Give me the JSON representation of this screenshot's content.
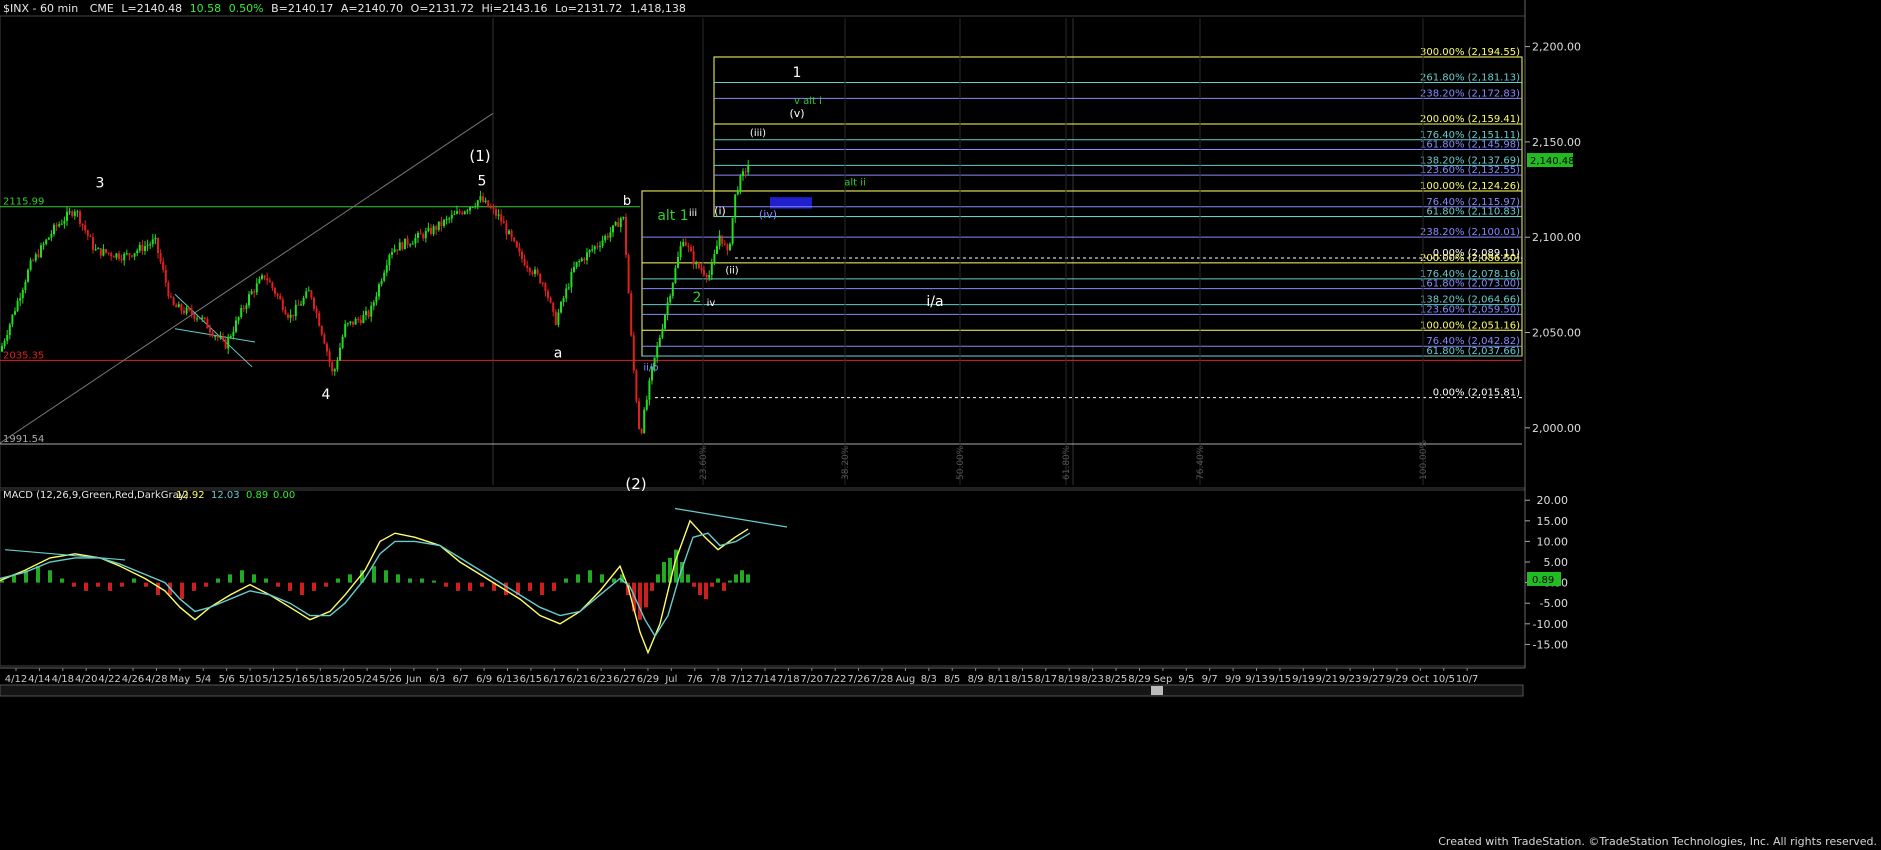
{
  "header": {
    "symbol": "$INX - 60 min",
    "exchange": "CME",
    "last": "L=2140.48",
    "change": "10.58",
    "change_pct": "0.50%",
    "bid": "B=2140.17",
    "ask": "A=2140.70",
    "open": "O=2131.72",
    "high": "Hi=2143.16",
    "low": "Lo=2131.72",
    "volume": "1,418,138"
  },
  "colors": {
    "background": "#000000",
    "up_bar": "#22dd22",
    "down_bar": "#e02020",
    "fib_yellow": "#ffff66",
    "fib_blue": "#8888ff",
    "fib_teal": "#66cccc",
    "macd_line": "#ffff66",
    "signal_line": "#66cccc",
    "hist_pos": "#22aa22",
    "hist_neg": "#cc2020",
    "wave_label": "#ffffff",
    "green_label": "#33cc33"
  },
  "chart_data": [
    {
      "type": "candlestick",
      "title": "$INX - 60 min",
      "y_ticks": [
        "2,200.00",
        "2,150.00",
        "2,100.00",
        "2,050.00",
        "2,000.00"
      ],
      "ylim": [
        1970,
        2215
      ],
      "last_price_label": "2,140.48",
      "x_ticks": [
        "4/12",
        "4/14",
        "4/18",
        "4/20",
        "4/22",
        "4/26",
        "4/28",
        "May",
        "5/4",
        "5/6",
        "5/10",
        "5/12",
        "5/16",
        "5/18",
        "5/20",
        "5/24",
        "5/26",
        "Jun",
        "6/3",
        "6/7",
        "6/9",
        "6/13",
        "6/15",
        "6/17",
        "6/21",
        "6/23",
        "6/27",
        "6/29",
        "Jul",
        "7/6",
        "7/8",
        "7/12",
        "7/14",
        "7/18",
        "7/20",
        "7/22",
        "7/26",
        "7/28",
        "Aug",
        "8/3",
        "8/5",
        "8/9",
        "8/11",
        "8/15",
        "8/17",
        "8/19",
        "8/23",
        "8/25",
        "8/29",
        "Sep",
        "9/5",
        "9/7",
        "9/9",
        "9/13",
        "9/15",
        "9/19",
        "9/21",
        "9/23",
        "9/27",
        "9/29",
        "Oct",
        "10/5",
        "10/7"
      ],
      "price_path": [
        {
          "x": 0,
          "y": 2040
        },
        {
          "x": 30,
          "y": 2085
        },
        {
          "x": 55,
          "y": 2105
        },
        {
          "x": 75,
          "y": 2115
        },
        {
          "x": 95,
          "y": 2093
        },
        {
          "x": 125,
          "y": 2090
        },
        {
          "x": 155,
          "y": 2098
        },
        {
          "x": 172,
          "y": 2064
        },
        {
          "x": 200,
          "y": 2058
        },
        {
          "x": 225,
          "y": 2043
        },
        {
          "x": 250,
          "y": 2070
        },
        {
          "x": 265,
          "y": 2080
        },
        {
          "x": 290,
          "y": 2058
        },
        {
          "x": 310,
          "y": 2072
        },
        {
          "x": 325,
          "y": 2045
        },
        {
          "x": 333,
          "y": 2027
        },
        {
          "x": 345,
          "y": 2053
        },
        {
          "x": 370,
          "y": 2060
        },
        {
          "x": 390,
          "y": 2093
        },
        {
          "x": 430,
          "y": 2103
        },
        {
          "x": 480,
          "y": 2120
        },
        {
          "x": 500,
          "y": 2110
        },
        {
          "x": 520,
          "y": 2090
        },
        {
          "x": 545,
          "y": 2075
        },
        {
          "x": 555,
          "y": 2055
        },
        {
          "x": 575,
          "y": 2085
        },
        {
          "x": 595,
          "y": 2095
        },
        {
          "x": 615,
          "y": 2105
        },
        {
          "x": 623,
          "y": 2112
        },
        {
          "x": 627,
          "y": 2085
        },
        {
          "x": 632,
          "y": 2040
        },
        {
          "x": 640,
          "y": 1995
        },
        {
          "x": 652,
          "y": 2030
        },
        {
          "x": 665,
          "y": 2060
        },
        {
          "x": 683,
          "y": 2100
        },
        {
          "x": 696,
          "y": 2085
        },
        {
          "x": 710,
          "y": 2080
        },
        {
          "x": 720,
          "y": 2102
        },
        {
          "x": 728,
          "y": 2090
        },
        {
          "x": 736,
          "y": 2125
        },
        {
          "x": 750,
          "y": 2140
        }
      ],
      "fib_levels": [
        {
          "label": "300.00% (2,194.55)",
          "value": 2194.55,
          "color": "#ffff66"
        },
        {
          "label": "261.80% (2,181.13)",
          "value": 2181.13,
          "color": "#66cccc"
        },
        {
          "label": "238.20% (2,172.83)",
          "value": 2172.83,
          "color": "#8888ff"
        },
        {
          "label": "200.00% (2,159.41)",
          "value": 2159.41,
          "color": "#ffff66"
        },
        {
          "label": "176.40% (2,151.11)",
          "value": 2151.11,
          "color": "#66cccc"
        },
        {
          "label": "161.80% (2,145.98)",
          "value": 2145.98,
          "color": "#8888ff"
        },
        {
          "label": "138.20% (2,137.69)",
          "value": 2137.69,
          "color": "#66cccc"
        },
        {
          "label": "123.60% (2,132.55)",
          "value": 2132.55,
          "color": "#8888ff"
        },
        {
          "label": "100.00% (2,124.26)",
          "value": 2124.26,
          "color": "#ffff66"
        },
        {
          "label": "76.40% (2,115.97)",
          "value": 2115.97,
          "color": "#8888ff"
        },
        {
          "label": "61.80% (2,110.83)",
          "value": 2110.83,
          "color": "#66cccc"
        },
        {
          "label": "238.20% (2,100.01)",
          "value": 2100.01,
          "color": "#8888ff"
        },
        {
          "label": "0.00% (2,089.11)",
          "value": 2089.11,
          "color": "#ffffff"
        },
        {
          "label": "200.00% (2,086.50)",
          "value": 2086.5,
          "color": "#ffff66"
        },
        {
          "label": "176.40% (2,078.16)",
          "value": 2078.16,
          "color": "#66cccc"
        },
        {
          "label": "161.80% (2,073.00)",
          "value": 2073.0,
          "color": "#8888ff"
        },
        {
          "label": "138.20% (2,064.66)",
          "value": 2064.66,
          "color": "#66cccc"
        },
        {
          "label": "123.60% (2,059.50)",
          "value": 2059.5,
          "color": "#8888ff"
        },
        {
          "label": "100.00% (2,051.16)",
          "value": 2051.16,
          "color": "#ffff66"
        },
        {
          "label": "76.40% (2,042.82)",
          "value": 2042.82,
          "color": "#8888ff"
        },
        {
          "label": "61.80% (2,037.66)",
          "value": 2037.66,
          "color": "#66cccc"
        },
        {
          "label": "0.00% (2,015.81)",
          "value": 2015.81,
          "color": "#ffffff"
        }
      ],
      "horizontal_levels": [
        {
          "label": "2115.99",
          "value": 2115.99,
          "color": "#33cc33"
        },
        {
          "label": "2035.35",
          "value": 2035.35,
          "color": "#e02020"
        },
        {
          "label": "1991.54",
          "value": 1991.54,
          "color": "#aaaaaa"
        }
      ],
      "time_fibs": [
        "23.60%",
        "38.20%",
        "50.00%",
        "61.80%",
        "76.40%",
        "100.00%"
      ],
      "wave_labels": [
        "3",
        "(1)",
        "5",
        "b",
        "4",
        "a",
        "(2)",
        "alt 1",
        "iii",
        "2",
        "iv",
        "(i)",
        "(ii)",
        "(iii)",
        "(iv)",
        "(v)",
        "1",
        "v alt i",
        "alt ii",
        "i/a",
        "ii/b"
      ]
    },
    {
      "type": "line",
      "title": "MACD (12,26,9,Green,Red,DarkGray)",
      "values_shown": [
        "12.92",
        "12.03",
        "0.89",
        "0.00"
      ],
      "y_ticks": [
        "20.00",
        "15.00",
        "10.00",
        "5.00",
        "0.00",
        "-5.00",
        "-10.00",
        "-15.00"
      ],
      "ylim": [
        -20,
        22
      ],
      "current_label": "0.89",
      "series": [
        {
          "name": "MACD",
          "points": [
            [
              0,
              0.5
            ],
            [
              25,
              3
            ],
            [
              50,
              6
            ],
            [
              75,
              7
            ],
            [
              100,
              6
            ],
            [
              120,
              4
            ],
            [
              145,
              1
            ],
            [
              165,
              -2
            ],
            [
              180,
              -6
            ],
            [
              195,
              -9
            ],
            [
              210,
              -6
            ],
            [
              230,
              -3
            ],
            [
              250,
              -0.5
            ],
            [
              270,
              -3
            ],
            [
              290,
              -6
            ],
            [
              310,
              -9
            ],
            [
              330,
              -7
            ],
            [
              345,
              -3
            ],
            [
              365,
              3
            ],
            [
              380,
              10
            ],
            [
              395,
              12
            ],
            [
              415,
              11
            ],
            [
              440,
              9
            ],
            [
              460,
              5
            ],
            [
              480,
              2
            ],
            [
              500,
              -1
            ],
            [
              520,
              -4
            ],
            [
              540,
              -8
            ],
            [
              560,
              -10
            ],
            [
              580,
              -7
            ],
            [
              600,
              -2
            ],
            [
              620,
              4
            ],
            [
              628,
              -1
            ],
            [
              640,
              -12
            ],
            [
              648,
              -17
            ],
            [
              660,
              -10
            ],
            [
              675,
              5
            ],
            [
              690,
              15
            ],
            [
              705,
              11
            ],
            [
              718,
              8
            ],
            [
              735,
              11
            ],
            [
              748,
              13
            ]
          ]
        },
        {
          "name": "Signal",
          "points": [
            [
              0,
              1
            ],
            [
              25,
              2.5
            ],
            [
              50,
              5
            ],
            [
              75,
              6
            ],
            [
              100,
              6
            ],
            [
              120,
              4.5
            ],
            [
              145,
              2
            ],
            [
              165,
              0
            ],
            [
              180,
              -4
            ],
            [
              195,
              -7
            ],
            [
              210,
              -6
            ],
            [
              230,
              -4
            ],
            [
              250,
              -2
            ],
            [
              270,
              -3
            ],
            [
              290,
              -5
            ],
            [
              310,
              -8
            ],
            [
              330,
              -8
            ],
            [
              345,
              -5
            ],
            [
              365,
              1
            ],
            [
              380,
              7
            ],
            [
              395,
              10
            ],
            [
              415,
              10
            ],
            [
              440,
              9
            ],
            [
              460,
              6
            ],
            [
              480,
              3
            ],
            [
              500,
              0
            ],
            [
              520,
              -3
            ],
            [
              540,
              -6
            ],
            [
              560,
              -8
            ],
            [
              580,
              -7
            ],
            [
              600,
              -3
            ],
            [
              620,
              1
            ],
            [
              630,
              -1
            ],
            [
              645,
              -9
            ],
            [
              655,
              -13
            ],
            [
              668,
              -8
            ],
            [
              680,
              2
            ],
            [
              693,
              11
            ],
            [
              708,
              12
            ],
            [
              720,
              9
            ],
            [
              736,
              10
            ],
            [
              750,
              12
            ]
          ]
        }
      ],
      "histogram": [
        [
          0,
          0.5
        ],
        [
          12,
          2
        ],
        [
          24,
          3
        ],
        [
          36,
          4
        ],
        [
          48,
          3
        ],
        [
          60,
          1
        ],
        [
          72,
          -1
        ],
        [
          84,
          -2
        ],
        [
          96,
          -1
        ],
        [
          108,
          -2
        ],
        [
          120,
          -1
        ],
        [
          132,
          1
        ],
        [
          144,
          -1
        ],
        [
          156,
          -3
        ],
        [
          168,
          -3
        ],
        [
          180,
          -4
        ],
        [
          192,
          -2
        ],
        [
          204,
          -1
        ],
        [
          216,
          1
        ],
        [
          228,
          2
        ],
        [
          240,
          3
        ],
        [
          252,
          2
        ],
        [
          264,
          1
        ],
        [
          276,
          -1
        ],
        [
          288,
          -2
        ],
        [
          300,
          -3
        ],
        [
          312,
          -2
        ],
        [
          324,
          -1
        ],
        [
          336,
          1
        ],
        [
          348,
          2
        ],
        [
          360,
          3
        ],
        [
          372,
          4
        ],
        [
          384,
          3
        ],
        [
          396,
          2
        ],
        [
          408,
          1
        ],
        [
          420,
          1
        ],
        [
          432,
          0.5
        ],
        [
          444,
          -1
        ],
        [
          456,
          -2
        ],
        [
          468,
          -2
        ],
        [
          480,
          -1
        ],
        [
          492,
          -2
        ],
        [
          504,
          -3
        ],
        [
          516,
          -3
        ],
        [
          528,
          -2
        ],
        [
          540,
          -3
        ],
        [
          552,
          -2
        ],
        [
          564,
          1
        ],
        [
          576,
          2
        ],
        [
          588,
          3
        ],
        [
          600,
          2
        ],
        [
          612,
          1
        ],
        [
          620,
          2
        ],
        [
          626,
          -3
        ],
        [
          632,
          -7
        ],
        [
          638,
          -9
        ],
        [
          644,
          -6
        ],
        [
          650,
          -2
        ],
        [
          656,
          2
        ],
        [
          662,
          5
        ],
        [
          668,
          6
        ],
        [
          674,
          8
        ],
        [
          680,
          5
        ],
        [
          686,
          2
        ],
        [
          692,
          -1
        ],
        [
          698,
          -3
        ],
        [
          704,
          -4
        ],
        [
          710,
          -1
        ],
        [
          716,
          1
        ],
        [
          722,
          -2
        ],
        [
          728,
          0.5
        ],
        [
          734,
          2
        ],
        [
          740,
          3
        ],
        [
          746,
          2
        ]
      ],
      "divergence_lines": 2
    }
  ],
  "footer": {
    "credit": "Created with TradeStation. ©TradeStation Technologies, Inc. All rights reserved."
  }
}
